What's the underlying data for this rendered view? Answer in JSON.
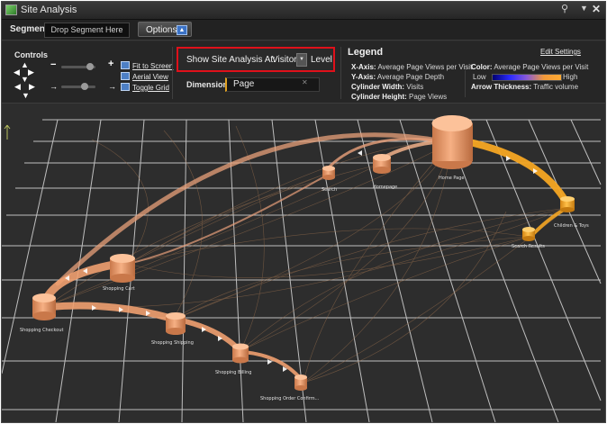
{
  "window": {
    "title": "Site Analysis"
  },
  "toolbar": {
    "segment_label": "Segment:",
    "segment_placeholder": "Drop Segment Here",
    "options_label": "Options"
  },
  "controls": {
    "title": "Controls",
    "fit_to_screen": "Fit to Screen",
    "aerial_view": "Aerial View",
    "toggle_grid": "Toggle Grid"
  },
  "analysis": {
    "prefix": "Show Site Analysis At:",
    "level_value": "Visitor",
    "suffix": "Level"
  },
  "dimension": {
    "label": "Dimension:",
    "value": "Page"
  },
  "legend": {
    "title": "Legend",
    "edit_settings": "Edit Settings",
    "x_axis_label": "X-Axis:",
    "x_axis_value": "Average Page Views per Visit",
    "y_axis_label": "Y-Axis:",
    "y_axis_value": "Average Page Depth",
    "cyl_width_label": "Cylinder Width:",
    "cyl_width_value": "Visits",
    "cyl_height_label": "Cylinder Height:",
    "cyl_height_value": "Page Views",
    "color_label": "Color:",
    "color_value": "Average Page Views per Visit",
    "color_low": "Low",
    "color_high": "High",
    "arrow_label": "Arrow Thickness:",
    "arrow_value": "Traffic volume"
  },
  "colors": {
    "accent_red": "#e0101a",
    "node_peach": "#f0a070",
    "node_orange": "#f5a623"
  },
  "nodes": [
    {
      "id": "home",
      "label": "Home Page"
    },
    {
      "id": "n_mid1",
      "label": "Homepage"
    },
    {
      "id": "n_mid2",
      "label": "Search"
    },
    {
      "id": "children",
      "label": "Children & Toys"
    },
    {
      "id": "search_results",
      "label": "Search Results"
    },
    {
      "id": "cart",
      "label": "Shopping Cart"
    },
    {
      "id": "checkout",
      "label": "Shopping Checkout"
    },
    {
      "id": "shipping",
      "label": "Shopping Shipping"
    },
    {
      "id": "billing",
      "label": "Shopping Billing"
    },
    {
      "id": "confirm",
      "label": "Shopping Order Confirm..."
    }
  ]
}
